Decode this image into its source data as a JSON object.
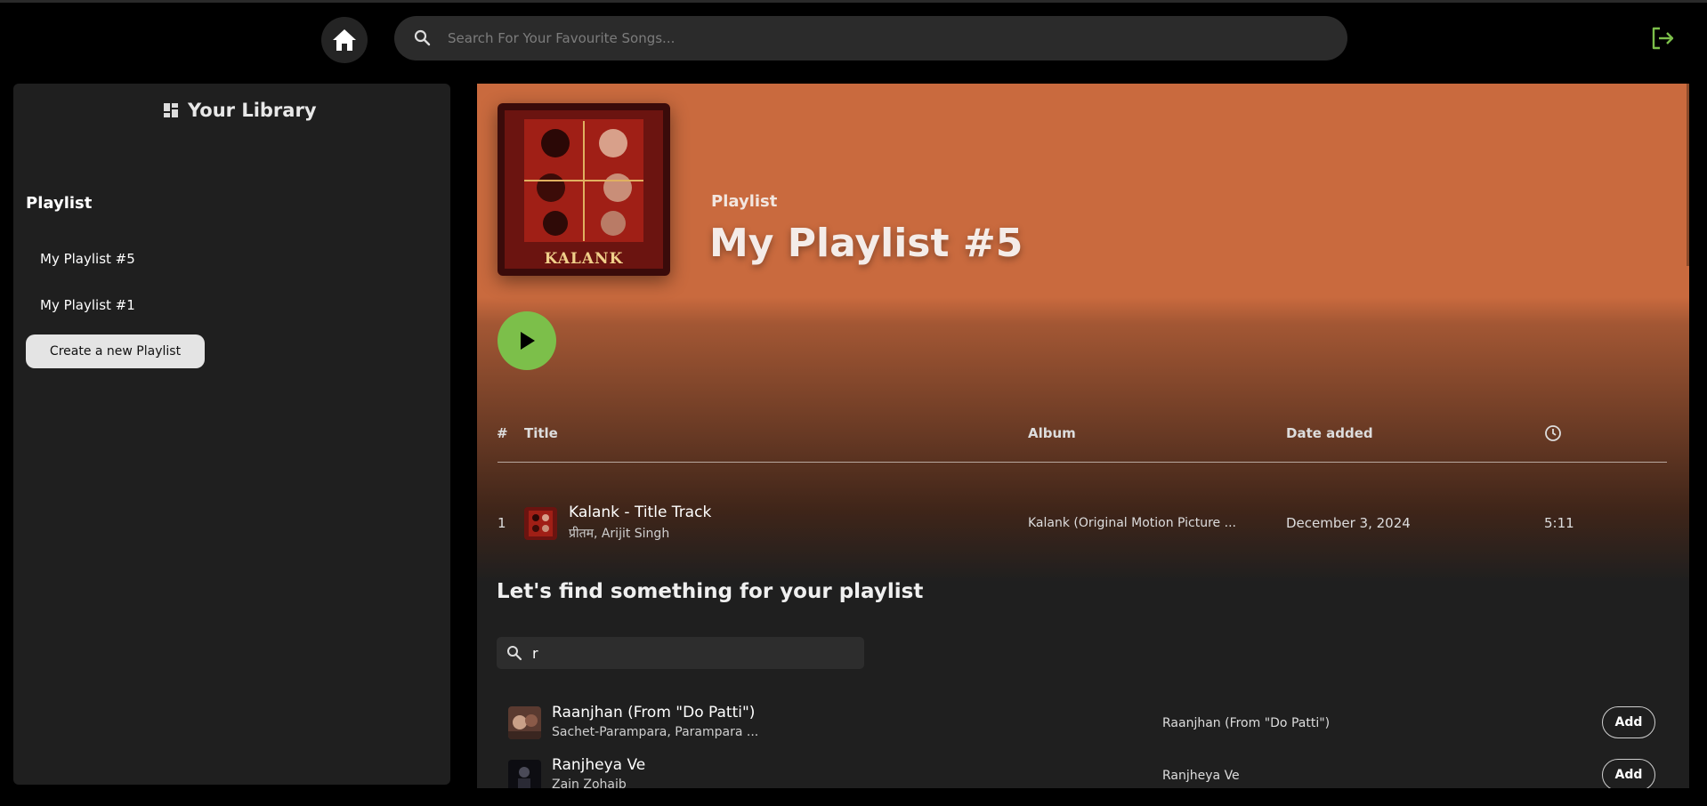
{
  "topbar": {
    "search_placeholder": "Search For Your Favourite Songs..."
  },
  "sidebar": {
    "title": "Your Library",
    "section_title": "Playlist",
    "playlists": [
      "My Playlist #5",
      "My Playlist #1"
    ],
    "create_label": "Create a new Playlist"
  },
  "playlist": {
    "type_label": "Playlist",
    "name": "My Playlist #5",
    "cover_text": "KALANK"
  },
  "table": {
    "headers": {
      "num": "#",
      "title": "Title",
      "album": "Album",
      "date": "Date added"
    },
    "rows": [
      {
        "num": "1",
        "title": "Kalank - Title Track",
        "artist": "प्रीतम, Arijit Singh",
        "album": "Kalank (Original Motion Picture ...",
        "date": "December 3, 2024",
        "duration": "5:11"
      }
    ]
  },
  "finder": {
    "title": "Let's find something for your playlist",
    "query": "r",
    "results": [
      {
        "title": "Raanjhan (From \"Do Patti\")",
        "artist": "Sachet-Parampara, Parampara ...",
        "album": "Raanjhan (From \"Do Patti\")",
        "button": "Add"
      },
      {
        "title": "Ranjheya Ve",
        "artist": "Zain Zohaib",
        "album": "Ranjheya Ve",
        "button": "Add"
      }
    ]
  },
  "colors": {
    "accent_green": "#7cbf4a",
    "header_orange": "#c96a3e",
    "logout_green": "#7cbf4a"
  }
}
